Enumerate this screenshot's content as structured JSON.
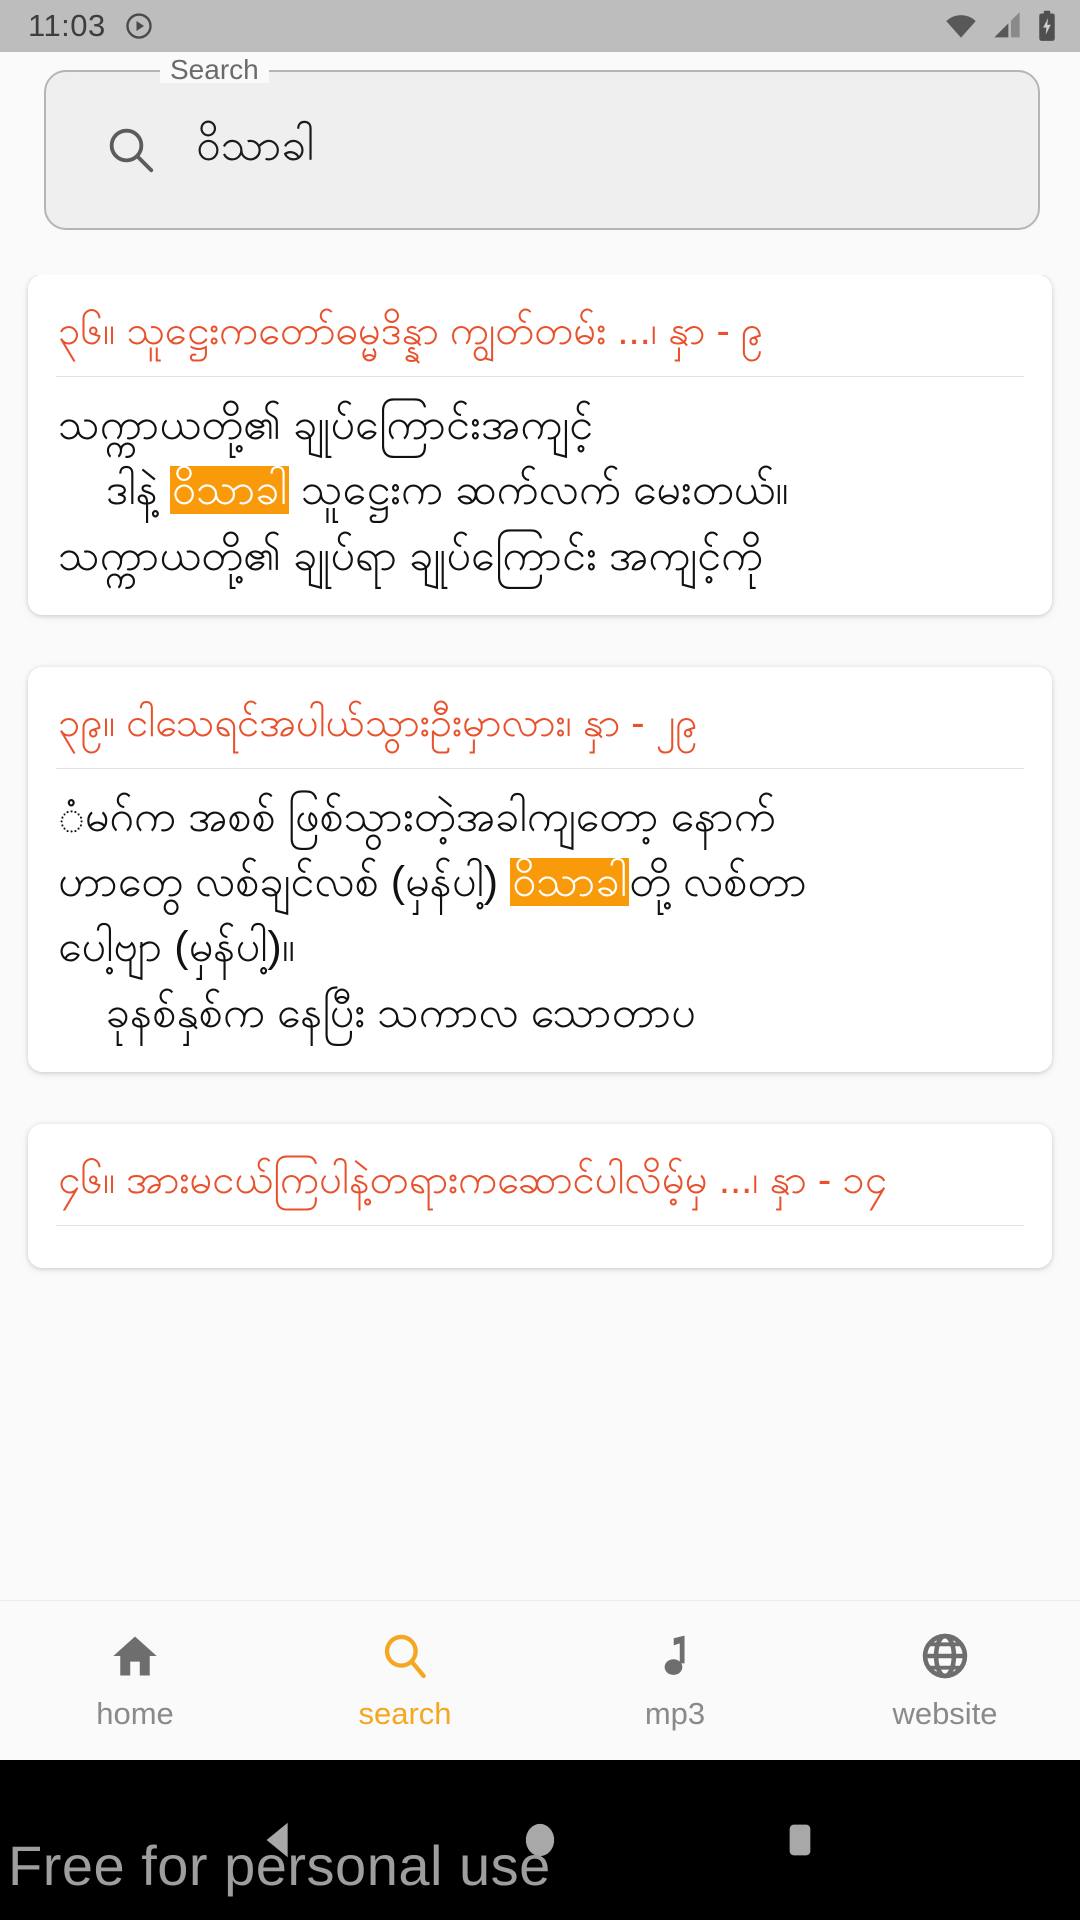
{
  "status_bar": {
    "time": "11:03",
    "left_icons": [
      "play-circle-icon"
    ],
    "right_icons": [
      "wifi-icon",
      "cellular-signal-icon",
      "battery-charging-icon"
    ],
    "background_color": "#bdbdbd"
  },
  "search": {
    "label": "Search",
    "value": "ဝိသာခါ",
    "placeholder": "Search",
    "icon": "search-icon"
  },
  "theme": {
    "title_color": "#e8512b",
    "highlight_color": "#f99a0b",
    "highlight_text_color": "#ffffff",
    "active_nav_color": "#f5a623",
    "inactive_nav_color": "#8a8a8a",
    "card_background": "#ffffff",
    "page_background": "#fafafa"
  },
  "results": [
    {
      "title": "၃၆။ သူဋ္ဌေးကတော်ဓမ္မဒိန္နာ ကျွတ်တမ်း ...၊ နှာ - ၉",
      "lines": [
        [
          {
            "text": "သက္ကာယတို့၏ ချုပ်ကြောင်းအကျင့်",
            "highlight": false
          }
        ],
        [
          {
            "text": "    ဒါနဲ့ ",
            "highlight": false
          },
          {
            "text": "ဝိသာခါ",
            "highlight": true
          },
          {
            "text": " သူဋ္ဌေးက ဆက်လက် မေးတယ်။",
            "highlight": false
          }
        ],
        [
          {
            "text": "သက္ကာယတို့၏ ချုပ်ရာ ချုပ်ကြောင်း အကျင့်ကို",
            "highlight": false
          }
        ]
      ]
    },
    {
      "title": "၃၉။ ငါသေရင်အပါယ်သွားဦးမှာလား၊ နှာ - ၂၉",
      "lines": [
        [
          {
            "text": "ံမဂ်က အစစ် ဖြစ်သွားတဲ့အခါကျတော့ နောက်",
            "highlight": false
          }
        ],
        [
          {
            "text": "ဟာတွေ လစ်ချင်လစ် (မှန်ပါ့) ",
            "highlight": false
          },
          {
            "text": "ဝိသာခါ",
            "highlight": true
          },
          {
            "text": "တို့ လစ်တာ",
            "highlight": false
          }
        ],
        [
          {
            "text": "ပေါ့ဗျာ (မှန်ပါ့)။",
            "highlight": false
          }
        ],
        [
          {
            "text": "    ခုနစ်နှစ်က နေပြီး သကာလ သောတာပ",
            "highlight": false
          }
        ]
      ]
    },
    {
      "title": "၄၆။ အားမငယ်ကြပါနဲ့တရားကဆောင်ပါလိမ့်မှ ...၊ နှာ - ၁၄",
      "lines": []
    }
  ],
  "bottom_nav": {
    "items": [
      {
        "label": "home",
        "icon": "home-icon",
        "active": false
      },
      {
        "label": "search",
        "icon": "search-icon",
        "active": true
      },
      {
        "label": "mp3",
        "icon": "music-note-icon",
        "active": false
      },
      {
        "label": "website",
        "icon": "globe-icon",
        "active": false
      }
    ]
  },
  "android_nav": {
    "icons": [
      "back-triangle-icon",
      "home-circle-icon",
      "recents-square-icon"
    ]
  },
  "watermark": {
    "text": "Free for personal use"
  }
}
